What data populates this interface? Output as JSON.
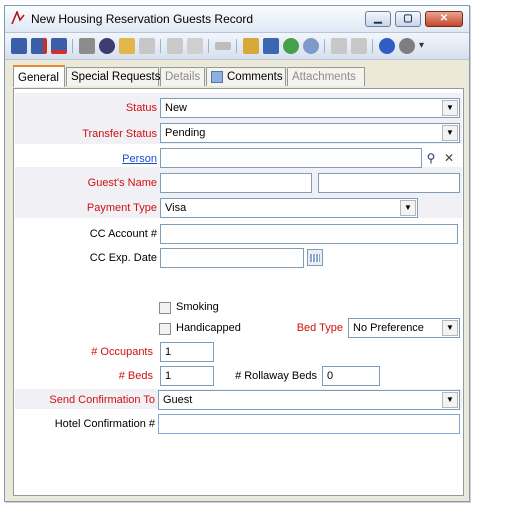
{
  "window": {
    "title": "New Housing Reservation Guests Record"
  },
  "tabs": [
    {
      "label": "General",
      "state": "active"
    },
    {
      "label": "Special Requests",
      "state": "normal"
    },
    {
      "label": "Details",
      "state": "disabled"
    },
    {
      "label": "Comments",
      "state": "normal"
    },
    {
      "label": "Attachments",
      "state": "disabled"
    }
  ],
  "form": {
    "status": {
      "label": "Status",
      "value": "New"
    },
    "transfer_status": {
      "label": "Transfer Status",
      "value": "Pending"
    },
    "person": {
      "label": "Person",
      "value": ""
    },
    "guest_name": {
      "label": "Guest's Name",
      "first": "",
      "last": ""
    },
    "payment_type": {
      "label": "Payment Type",
      "value": "Visa"
    },
    "cc_account": {
      "label": "CC Account #",
      "value": ""
    },
    "cc_exp_date": {
      "label": "CC Exp. Date",
      "value": ""
    },
    "smoking": {
      "label": "Smoking",
      "checked": false
    },
    "handicapped": {
      "label": "Handicapped",
      "checked": false
    },
    "bed_type": {
      "label": "Bed Type",
      "value": "No Preference"
    },
    "occupants": {
      "label": "# Occupants",
      "value": "1"
    },
    "beds": {
      "label": "# Beds",
      "value": "1"
    },
    "rollaway_beds": {
      "label": "# Rollaway Beds",
      "value": "0"
    },
    "send_confirmation_to": {
      "label": "Send Confirmation To",
      "value": "Guest"
    },
    "hotel_confirmation": {
      "label": "Hotel Confirmation #",
      "value": ""
    }
  },
  "colors": {
    "required_label": "#d01010",
    "link": "#1a4fd0",
    "active_tab_accent": "#e68b2c"
  }
}
